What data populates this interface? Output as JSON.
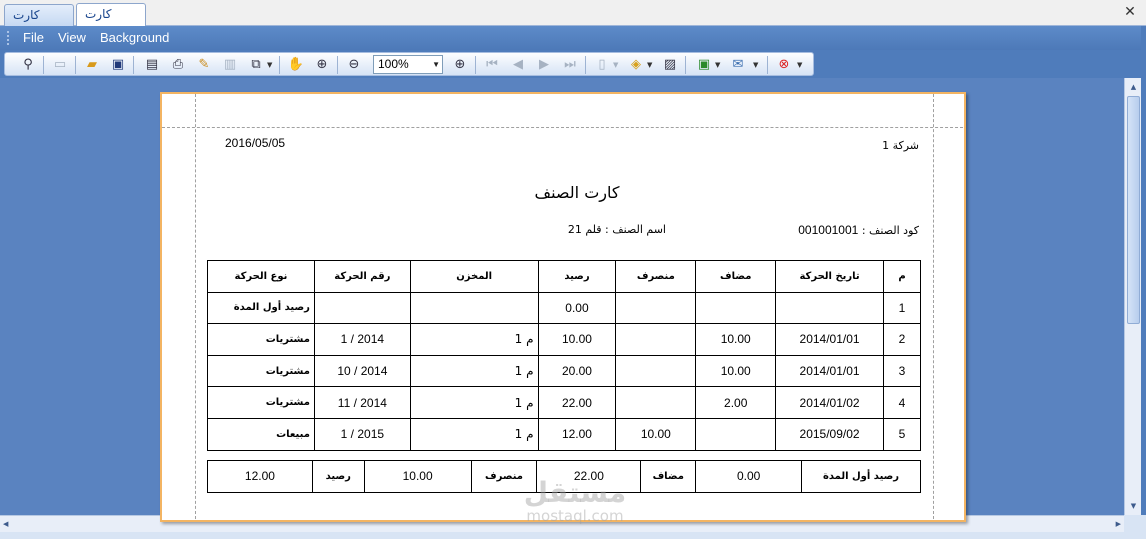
{
  "tabs": [
    "كارت الصنف",
    "كارت الصنف"
  ],
  "window": {
    "close": "✕"
  },
  "menu": [
    "File",
    "View",
    "Background"
  ],
  "toolbar": {
    "zoom": "100%",
    "icons": [
      "find-icon",
      "open-icon",
      "save-icon",
      "print-setup-icon",
      "print-icon",
      "quick-print-icon",
      "page-setup-icon",
      "multi-page-icon",
      "hand-icon",
      "magnifier-icon",
      "zoom-out-icon",
      "zoom-in-icon",
      "first-page-icon",
      "prev-page-icon",
      "next-page-icon",
      "last-page-icon",
      "page-layout-icon",
      "page-color-icon",
      "watermark-icon",
      "export-icon",
      "email-icon",
      "close-preview-icon"
    ]
  },
  "report": {
    "company": "شركة 1",
    "date": "2016/05/05",
    "title": "كارت الصنف",
    "item_code_label": "كود الصنف :",
    "item_code": "001001001",
    "item_name_label": "اسم الصنف :",
    "item_name": "قلم 21",
    "headers": [
      "م",
      "تاريخ الحركة",
      "مضاف",
      "منصرف",
      "رصيد",
      "المخزن",
      "رقم الحركة",
      "نوع الحركة"
    ],
    "rows": [
      [
        "1",
        "",
        "",
        "",
        "0.00",
        "",
        "",
        "رصيد أول المدة"
      ],
      [
        "2",
        "2014/01/01",
        "10.00",
        "",
        "10.00",
        "م 1",
        "1 / 2014",
        "مشتريات"
      ],
      [
        "3",
        "2014/01/01",
        "10.00",
        "",
        "20.00",
        "م 1",
        "10 / 2014",
        "مشتريات"
      ],
      [
        "4",
        "2014/01/02",
        "2.00",
        "",
        "22.00",
        "م 1",
        "11 / 2014",
        "مشتريات"
      ],
      [
        "5",
        "2015/09/02",
        "",
        "10.00",
        "12.00",
        "م 1",
        "1 / 2015",
        "مبيعات"
      ]
    ],
    "summary": {
      "opening_label": "رصيد أول المدة",
      "opening": "0.00",
      "added_label": "مضاف",
      "added": "22.00",
      "issued_label": "منصرف",
      "issued": "10.00",
      "balance_label": "رصيد",
      "balance": "12.00"
    }
  },
  "watermark": {
    "brand": "مستقل",
    "url": "mostaql.com"
  }
}
